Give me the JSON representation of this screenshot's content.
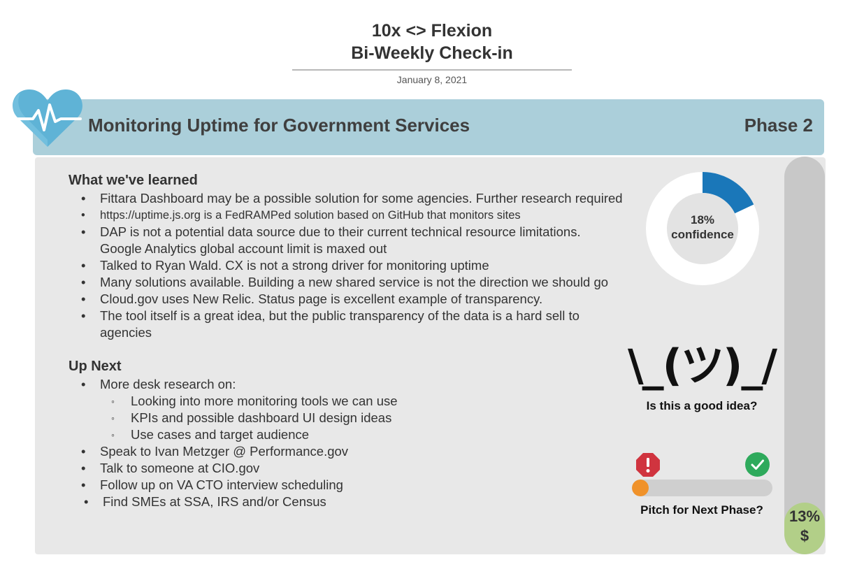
{
  "header": {
    "title_line1": "10x <> Flexion",
    "title_line2": "Bi-Weekly Check-in",
    "date": "January 8, 2021"
  },
  "banner": {
    "title": "Monitoring Uptime for Government Services",
    "phase": "Phase 2",
    "icon": "heartbeat-heart-icon",
    "color": "#abcfda"
  },
  "learned": {
    "heading": "What we've learned",
    "items": [
      "Fittara Dashboard may be a possible solution for some agencies. Further research required",
      "https://uptime.js.org is a FedRAMPed solution based on GitHub that monitors sites",
      "DAP is not a potential data source due to their current technical resource limitations. Google Analytics global account limit is maxed out",
      "Talked to Ryan Wald. CX is not a strong driver for monitoring uptime",
      "Many solutions available. Building a new shared service is not the direction we should go",
      "Cloud.gov uses New Relic. Status page is excellent example of transparency.",
      "The tool itself is a great idea, but the public transparency of the data is a hard sell to agencies"
    ]
  },
  "next": {
    "heading": "Up Next",
    "research_intro": "More desk research on:",
    "research_items": [
      "Looking into more monitoring tools we can use",
      "KPIs and possible dashboard UI design ideas",
      "Use cases and target audience"
    ],
    "items": [
      "Speak to Ivan Metzger @ Performance.gov",
      "Talk to someone at CIO.gov",
      "Follow up on VA CTO interview scheduling",
      "Find SMEs at SSA, IRS and/or Census"
    ]
  },
  "confidence": {
    "value": 18,
    "percent_label": "18%",
    "label": "confidence",
    "color": "#1a77b9"
  },
  "idea": {
    "shrug": "\\_(ツ)_/",
    "question": "Is this a good idea?"
  },
  "pitch": {
    "value": 0.12,
    "label": "Pitch for Next Phase?",
    "stop_icon": "stop-sign-icon",
    "check_icon": "check-circle-icon",
    "fill_color": "#f0922a"
  },
  "funding": {
    "value": 13,
    "percent_label": "13%",
    "symbol": "$",
    "fill_color": "#b2cf88"
  }
}
